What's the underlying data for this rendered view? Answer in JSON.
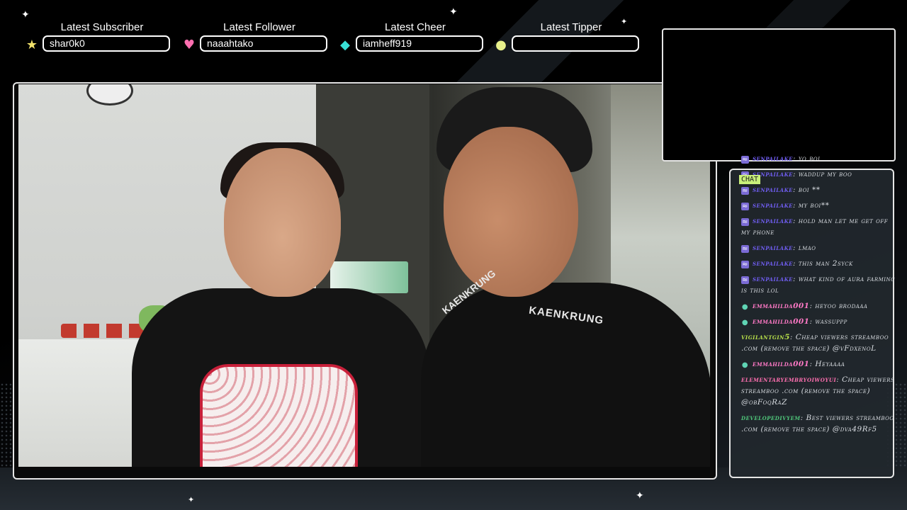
{
  "alerts": [
    {
      "title": "Latest Subscriber",
      "value": "shar0k0",
      "icon": "star-icon",
      "icon_glyph": "★",
      "icon_color": "#f3e36c"
    },
    {
      "title": "Latest Follower",
      "value": "naaahtako",
      "icon": "heart-icon",
      "icon_glyph": "♥",
      "icon_color": "#ff6fb0"
    },
    {
      "title": "Latest Cheer",
      "value": "iamheff919",
      "icon": "gem-icon",
      "icon_glyph": "◆",
      "icon_color": "#38e0d6"
    },
    {
      "title": "Latest Tipper",
      "value": "",
      "icon": "coin-icon",
      "icon_glyph": "●",
      "icon_color": "#e8f08a"
    }
  ],
  "video": {
    "shirt_text": "KAENKRUNG",
    "shirt_logo_text": "KAENKRUNG"
  },
  "chat": {
    "label": "CHAT",
    "messages": [
      {
        "badge": "sq",
        "badge_glyph": "≈",
        "user": "senpailake",
        "user_color": "#6f5df0",
        "text": "yo boi"
      },
      {
        "badge": "sq",
        "badge_glyph": "≈",
        "user": "senpailake",
        "user_color": "#6f5df0",
        "text": "waddup my boo"
      },
      {
        "badge": "sq",
        "badge_glyph": "≈",
        "user": "senpailake",
        "user_color": "#6f5df0",
        "text": "boi **"
      },
      {
        "badge": "sq",
        "badge_glyph": "≈",
        "user": "senpailake",
        "user_color": "#6f5df0",
        "text": "my boi**"
      },
      {
        "badge": "sq",
        "badge_glyph": "≈",
        "user": "senpailake",
        "user_color": "#6f5df0",
        "text": "hold man let me get off my phone"
      },
      {
        "badge": "sq",
        "badge_glyph": "≈",
        "user": "senpailake",
        "user_color": "#6f5df0",
        "text": "lmao"
      },
      {
        "badge": "sq",
        "badge_glyph": "≈",
        "user": "senpailake",
        "user_color": "#6f5df0",
        "text": "this man 2syck"
      },
      {
        "badge": "sq",
        "badge_glyph": "≈",
        "user": "senpailake",
        "user_color": "#6f5df0",
        "text": "what kind of aura farming is this lol"
      },
      {
        "badge": "orb",
        "badge_glyph": "●",
        "user": "emmahilda001",
        "user_color": "#ff79c6",
        "text": "heyoo brodaaa"
      },
      {
        "badge": "orb",
        "badge_glyph": "●",
        "user": "emmahilda001",
        "user_color": "#ff79c6",
        "text": "wassuppp"
      },
      {
        "badge": "",
        "badge_glyph": "",
        "user": "vigilantgin5",
        "user_color": "#b8e04a",
        "text": "Cheap viewers streamboo .com (remove the space) @vFdxenoL"
      },
      {
        "badge": "orb",
        "badge_glyph": "●",
        "user": "emmahilda001",
        "user_color": "#ff79c6",
        "text": "Heyaaaa"
      },
      {
        "badge": "",
        "badge_glyph": "",
        "user": "elementaryembryoiwoyui",
        "user_color": "#ff6fb0",
        "text": "Cheap viewers streamboo .com (remove the space) @obFoqRaZ"
      },
      {
        "badge": "",
        "badge_glyph": "",
        "user": "developedivyem",
        "user_color": "#4fc67a",
        "text": "Best viewers streamboo .com (remove the space) @dva49Rf5"
      }
    ]
  }
}
